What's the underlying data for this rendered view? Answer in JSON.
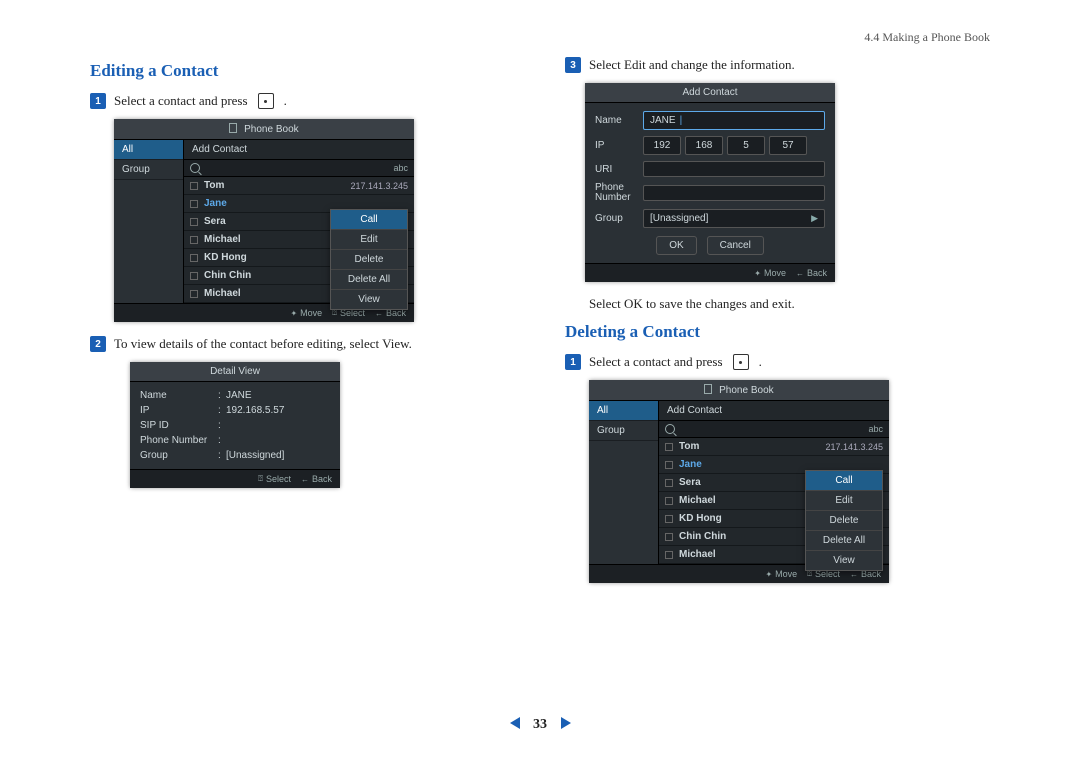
{
  "breadcrumb": "4.4 Making a Phone Book",
  "page_number": "33",
  "left": {
    "heading": "Editing a Contact",
    "step1": "Select a contact and press",
    "step1_suffix": ".",
    "step2": "To view details of the contact before editing, select View.",
    "phonebook": {
      "title": "Phone Book",
      "side": {
        "all": "All",
        "group": "Group"
      },
      "add_contact": "Add Contact",
      "abc": "abc",
      "rows": [
        {
          "name": "Tom",
          "ip": "217.141.3.245"
        },
        {
          "name": "Jane"
        },
        {
          "name": "Sera"
        },
        {
          "name": "Michael"
        },
        {
          "name": "KD Hong"
        },
        {
          "name": "Chin Chin"
        },
        {
          "name": "Michael"
        }
      ],
      "menu": {
        "call": "Call",
        "edit": "Edit",
        "delete": "Delete",
        "delete_all": "Delete All",
        "view": "View"
      },
      "footer": {
        "move": "Move",
        "select": "Select",
        "back": "Back"
      }
    },
    "detail": {
      "title": "Detail View",
      "name_k": "Name",
      "name_v": "JANE",
      "ip_k": "IP",
      "ip_v": "192.168.5.57",
      "sip_k": "SIP ID",
      "sip_v": "",
      "phone_k": "Phone Number",
      "phone_v": "",
      "group_k": "Group",
      "group_v": "[Unassigned]",
      "footer": {
        "select": "Select",
        "back": "Back"
      }
    }
  },
  "right": {
    "step3": "Select Edit and change the information.",
    "note": "Select OK to save the changes and exit.",
    "heading2": "Deleting a Contact",
    "del_step1": "Select a contact and press",
    "del_step1_suffix": ".",
    "form": {
      "title": "Add Contact",
      "name_k": "Name",
      "name_v": "JANE",
      "ip_k": "IP",
      "ip_v": [
        "192",
        "168",
        "5",
        "57"
      ],
      "uri_k": "URI",
      "phone_k": "Phone\nNumber",
      "group_k": "Group",
      "group_v": "[Unassigned]",
      "ok": "OK",
      "cancel": "Cancel",
      "footer": {
        "move": "Move",
        "back": "Back"
      }
    },
    "phonebook2": {
      "title": "Phone Book",
      "side": {
        "all": "All",
        "group": "Group"
      },
      "add_contact": "Add Contact",
      "abc": "abc",
      "rows": [
        {
          "name": "Tom",
          "ip": "217.141.3.245"
        },
        {
          "name": "Jane"
        },
        {
          "name": "Sera"
        },
        {
          "name": "Michael"
        },
        {
          "name": "KD Hong"
        },
        {
          "name": "Chin Chin"
        },
        {
          "name": "Michael"
        }
      ],
      "menu": {
        "call": "Call",
        "edit": "Edit",
        "delete": "Delete",
        "delete_all": "Delete All",
        "view": "View"
      },
      "footer": {
        "move": "Move",
        "select": "Select",
        "back": "Back"
      }
    }
  }
}
